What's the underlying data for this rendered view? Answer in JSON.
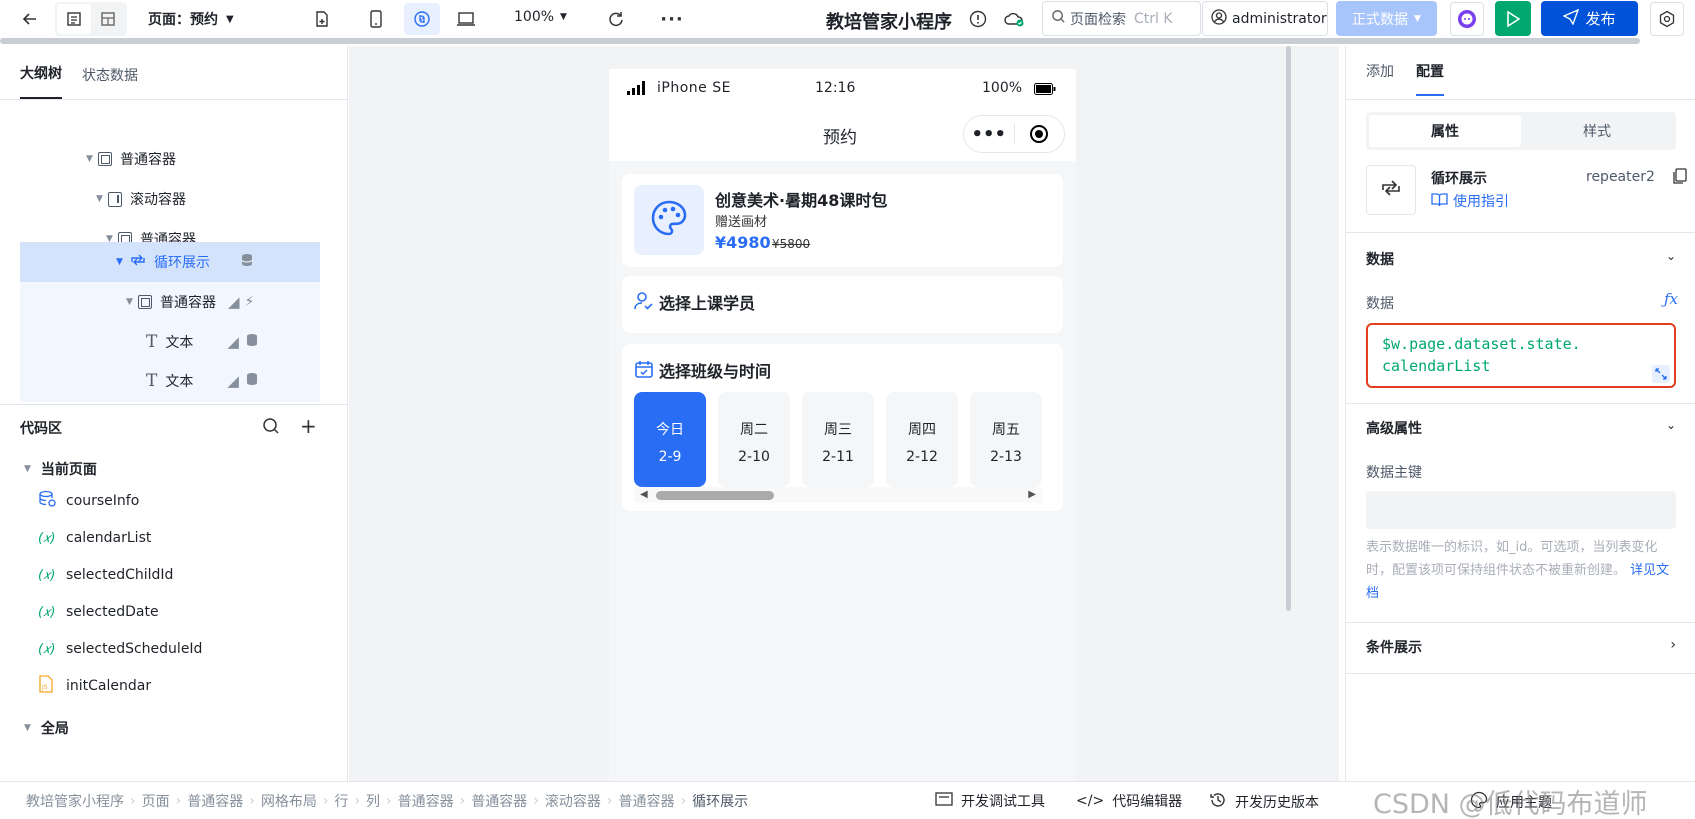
{
  "toolbar": {
    "page_label": "页面：预约",
    "zoom": "100%",
    "app_title": "教培管家小程序",
    "search_placeholder": "页面检索",
    "search_shortcut": "Ctrl K",
    "user": "administrator",
    "env": "正式数据",
    "publish": "发布"
  },
  "left": {
    "tabs": [
      "大纲树",
      "状态数据"
    ],
    "tree": [
      {
        "label": "普通容器"
      },
      {
        "label": "滚动容器"
      },
      {
        "label": "普通容器"
      },
      {
        "label": "循环展示"
      },
      {
        "label": "普通容器"
      },
      {
        "label": "文本"
      },
      {
        "label": "文本"
      }
    ],
    "code_title": "代码区",
    "current_page": "当前页面",
    "code_items": [
      "courseInfo",
      "calendarList",
      "selectedChildId",
      "selectedDate",
      "selectedScheduleId",
      "initCalendar"
    ],
    "global": "全局"
  },
  "phone": {
    "device": "iPhone SE",
    "time": "12:16",
    "battery": "100%",
    "nav_title": "预约",
    "course_title": "创意美术·暑期48课时包",
    "course_sub": "赠送画材",
    "price": "¥4980",
    "orig_price": "¥5800",
    "student_title": "选择上课学员",
    "class_title": "选择班级与时间",
    "days": [
      {
        "day": "今日",
        "date": "2-9"
      },
      {
        "day": "周二",
        "date": "2-10"
      },
      {
        "day": "周三",
        "date": "2-11"
      },
      {
        "day": "周四",
        "date": "2-12"
      },
      {
        "day": "周五",
        "date": "2-13"
      }
    ]
  },
  "right": {
    "tabs": [
      "添加",
      "配置"
    ],
    "seg": [
      "属性",
      "样式"
    ],
    "comp_name": "循环展示",
    "comp_id": "repeater2",
    "guide": "使用指引",
    "data_section": "数据",
    "data_label": "数据",
    "data_line1": "$w.page.dataset.state.",
    "data_line2": "calendarList",
    "adv_section": "高级属性",
    "key_label": "数据主键",
    "key_help": "表示数据唯一的标识，如_id。可选项，当列表变化时，配置该项可保持组件状态不被重新创建。",
    "doc_link": "详见文档",
    "cond_section": "条件展示"
  },
  "bottom": {
    "crumbs": [
      "教培管家小程序",
      "页面",
      "普通容器",
      "网格布局",
      "行",
      "列",
      "普通容器",
      "普通容器",
      "滚动容器",
      "普通容器",
      "循环展示"
    ],
    "debug": "开发调试工具",
    "code_editor": "代码编辑器",
    "history": "开发历史版本",
    "theme": "应用主题",
    "watermark": "CSDN @低代码布道师"
  }
}
